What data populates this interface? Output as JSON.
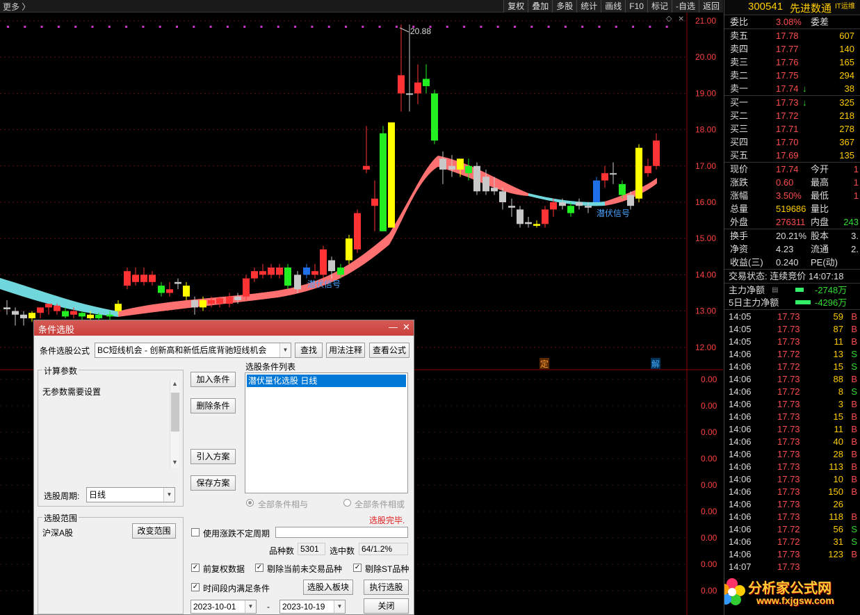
{
  "topbar": {
    "more": "更多 〉",
    "buttons": [
      "复权",
      "叠加",
      "多股",
      "统计",
      "画线",
      "F10",
      "标记",
      "-自选",
      "返回"
    ]
  },
  "chart": {
    "price_axis": [
      "21.00",
      "20.00",
      "19.00",
      "18.00",
      "17.00",
      "16.00",
      "15.00",
      "14.00",
      "13.00",
      "12.00"
    ],
    "peak_label": "20.88",
    "signal_label": "潜伏信号",
    "sub_axis": [
      "0.00",
      "0.00",
      "0.00",
      "0.00",
      "0.00",
      "0.00",
      "0.00",
      "0.00",
      "0.00"
    ],
    "marker_ding": "定",
    "marker_jie": "解"
  },
  "quote": {
    "code": "300541",
    "name": "先进数通",
    "tag": "IT运维",
    "wei_bi_label": "委比",
    "wei_bi": "3.08%",
    "wei_cha_label": "委差",
    "asks": [
      {
        "label": "卖五",
        "price": "17.78",
        "vol": "607"
      },
      {
        "label": "卖四",
        "price": "17.77",
        "vol": "140"
      },
      {
        "label": "卖三",
        "price": "17.76",
        "vol": "165"
      },
      {
        "label": "卖二",
        "price": "17.75",
        "vol": "294"
      },
      {
        "label": "卖一",
        "price": "17.74",
        "arrow": "↓",
        "vol": "38"
      }
    ],
    "bids": [
      {
        "label": "买一",
        "price": "17.73",
        "arrow": "↓",
        "vol": "325"
      },
      {
        "label": "买二",
        "price": "17.72",
        "vol": "218"
      },
      {
        "label": "买三",
        "price": "17.71",
        "vol": "278"
      },
      {
        "label": "买四",
        "price": "17.70",
        "vol": "367"
      },
      {
        "label": "买五",
        "price": "17.69",
        "vol": "135"
      }
    ],
    "stats": [
      {
        "l1": "现价",
        "v1": "17.74",
        "l2": "今开",
        "v2": "1"
      },
      {
        "l1": "涨跌",
        "v1": "0.60",
        "l2": "最高",
        "v2": "1"
      },
      {
        "l1": "涨幅",
        "v1": "3.50%",
        "l2": "最低",
        "v2": "1"
      },
      {
        "l1": "总量",
        "v1": "519686",
        "l2": "量比",
        "v2": ""
      },
      {
        "l1": "外盘",
        "v1": "276311",
        "l2": "内盘",
        "v2": "243"
      }
    ],
    "stats2": [
      {
        "l1": "换手",
        "v1": "20.21%",
        "l2": "股本",
        "v2": "3."
      },
      {
        "l1": "净资",
        "v1": "4.23",
        "l2": "流通",
        "v2": "2."
      },
      {
        "l1": "收益(三)",
        "v1": "0.240",
        "l2": "PE(动)",
        "v2": ""
      }
    ],
    "status": "交易状态: 连续竞价 14:07:18",
    "main_flow_label": "主力净额",
    "main_flow": "-2748万",
    "main_flow5_label": "5日主力净额",
    "main_flow5": "-4296万",
    "trades": [
      {
        "t": "14:05",
        "p": "17.73",
        "v": "59",
        "s": "B"
      },
      {
        "t": "14:05",
        "p": "17.73",
        "v": "87",
        "s": "B"
      },
      {
        "t": "14:05",
        "p": "17.73",
        "v": "11",
        "s": "B"
      },
      {
        "t": "14:06",
        "p": "17.72",
        "v": "13",
        "s": "S"
      },
      {
        "t": "14:06",
        "p": "17.72",
        "v": "15",
        "s": "S"
      },
      {
        "t": "14:06",
        "p": "17.73",
        "v": "88",
        "s": "B"
      },
      {
        "t": "14:06",
        "p": "17.72",
        "v": "8",
        "s": "S"
      },
      {
        "t": "14:06",
        "p": "17.73",
        "v": "3",
        "s": "B"
      },
      {
        "t": "14:06",
        "p": "17.73",
        "v": "15",
        "s": "B"
      },
      {
        "t": "14:06",
        "p": "17.73",
        "v": "11",
        "s": "B"
      },
      {
        "t": "14:06",
        "p": "17.73",
        "v": "40",
        "s": "B"
      },
      {
        "t": "14:06",
        "p": "17.73",
        "v": "28",
        "s": "B"
      },
      {
        "t": "14:06",
        "p": "17.73",
        "v": "113",
        "s": "B"
      },
      {
        "t": "14:06",
        "p": "17.73",
        "v": "10",
        "s": "B"
      },
      {
        "t": "14:06",
        "p": "17.73",
        "v": "150",
        "s": "B"
      },
      {
        "t": "14:06",
        "p": "17.73",
        "v": "26",
        "s": ""
      },
      {
        "t": "14:06",
        "p": "17.73",
        "v": "118",
        "s": "B"
      },
      {
        "t": "14:06",
        "p": "17.72",
        "v": "56",
        "s": "S"
      },
      {
        "t": "14:06",
        "p": "17.72",
        "v": "31",
        "s": "S"
      },
      {
        "t": "14:06",
        "p": "17.73",
        "v": "123",
        "s": "B"
      },
      {
        "t": "14:07",
        "p": "17.73",
        "v": "",
        "s": ""
      }
    ],
    "watermark": "分析家公式网",
    "watermark_url": "www.fxjgsw.com"
  },
  "dialog": {
    "title": "条件选股",
    "formula_label": "条件选股公式",
    "formula_value": "BC短线机会  -  创新高和新低后底背驰短线机会",
    "find_btn": "查找",
    "usage_btn": "用法注释",
    "view_btn": "查看公式",
    "params_group": "计算参数",
    "params_text": "无参数需要设置",
    "period_label": "选股周期:",
    "period_value": "日线",
    "range_group": "选股范围",
    "range_value": "沪深A股",
    "change_range_btn": "改变范围",
    "add_btn": "加入条件",
    "delete_btn": "删除条件",
    "import_btn": "引入方案",
    "save_btn": "保存方案",
    "list_label": "选股条件列表",
    "list_items": [
      "潜伏量化选股  日线"
    ],
    "and_label": "全部条件相与",
    "or_label": "全部条件相或",
    "done_text": "选股完毕.",
    "use_irregular": "使用涨跌不定周期",
    "count_label": "品种数",
    "count_value": "5301",
    "selected_label": "选中数",
    "selected_value": "64/1.2%",
    "chk_prior": "前复权数据",
    "chk_exclude_untraded": "剔除当前未交易品种",
    "chk_exclude_st": "剔除ST品种",
    "chk_period": "时间段内满足条件",
    "to_block_btn": "选股入板块",
    "exec_btn": "执行选股",
    "date_from": "2023-10-01",
    "date_dash": "-",
    "date_to": "2023-10-19",
    "close_btn": "关闭"
  },
  "colors": {
    "up": "#ff3333",
    "down": "#22ee22",
    "yellow": "#ffff00",
    "gray": "#c8c8c8",
    "blue": "#1e6fe8",
    "ribbon_up": "#ff7070",
    "ribbon_down": "#70d8dc"
  }
}
